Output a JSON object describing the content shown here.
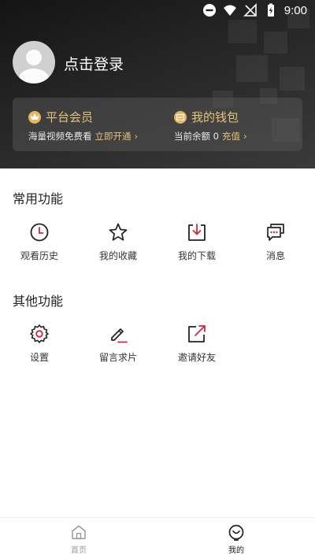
{
  "status_bar": {
    "time": "9:00"
  },
  "profile": {
    "login_label": "点击登录"
  },
  "vip": {
    "title": "平台会员",
    "subtitle": "海量视频免费看",
    "action": "立即开通"
  },
  "wallet": {
    "title": "我的钱包",
    "subtitle": "当前余额 0",
    "action": "充值"
  },
  "common_section": {
    "title": "常用功能",
    "items": [
      {
        "label": "观看历史",
        "icon": "clock-icon"
      },
      {
        "label": "我的收藏",
        "icon": "star-icon"
      },
      {
        "label": "我的下载",
        "icon": "download-icon"
      },
      {
        "label": "消息",
        "icon": "message-icon"
      }
    ]
  },
  "other_section": {
    "title": "其他功能",
    "items": [
      {
        "label": "设置",
        "icon": "gear-icon"
      },
      {
        "label": "留言求片",
        "icon": "edit-icon"
      },
      {
        "label": "邀请好友",
        "icon": "share-icon"
      }
    ]
  },
  "tabbar": {
    "items": [
      {
        "label": "首页",
        "icon": "home-icon",
        "active": false
      },
      {
        "label": "我的",
        "icon": "smiley-icon",
        "active": true
      }
    ]
  },
  "colors": {
    "accent_gold": "#e6c27a",
    "header_dark": "#1e1e1e",
    "icon_red": "#d0283c",
    "tab_inactive": "#999999",
    "tab_active": "#222222"
  }
}
